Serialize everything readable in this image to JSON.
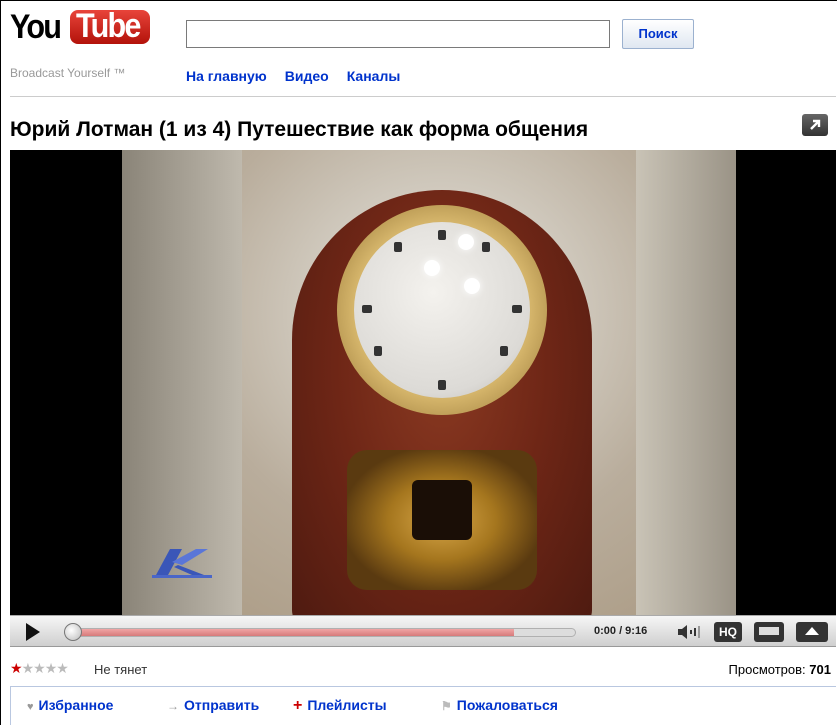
{
  "header": {
    "logo_you": "You",
    "logo_tube": "Tube",
    "tagline": "Broadcast Yourself ™",
    "search": {
      "value": "",
      "button_label": "Поиск"
    },
    "nav": [
      "На главную",
      "Видео",
      "Каналы"
    ]
  },
  "video": {
    "title": "Юрий Лотман (1 из 4) Путешествие как форма общения",
    "time": "0:00 / 9:16",
    "hq_label": "HQ",
    "progress_loaded": 0.88
  },
  "rating": {
    "stars_filled": 1,
    "stars_total": 5,
    "text": "Не тянет",
    "views_label": "Просмотров:",
    "views_count": "701"
  },
  "actions": [
    {
      "icon": "heart-icon",
      "glyph": "♥",
      "label": "Избранное",
      "color": "#999999"
    },
    {
      "icon": "send-arrow-icon",
      "glyph": "→",
      "label": "Отправить",
      "color": "#999999"
    },
    {
      "icon": "plus-icon",
      "glyph": "+",
      "label": "Плейлисты",
      "color": "#cc0000"
    },
    {
      "icon": "flag-icon",
      "glyph": "⚑",
      "label": "Пожаловаться",
      "color": "#999999"
    }
  ],
  "colors": {
    "link": "#0033cc",
    "brand_red": "#cc0000",
    "progress": "#d77a7a"
  }
}
